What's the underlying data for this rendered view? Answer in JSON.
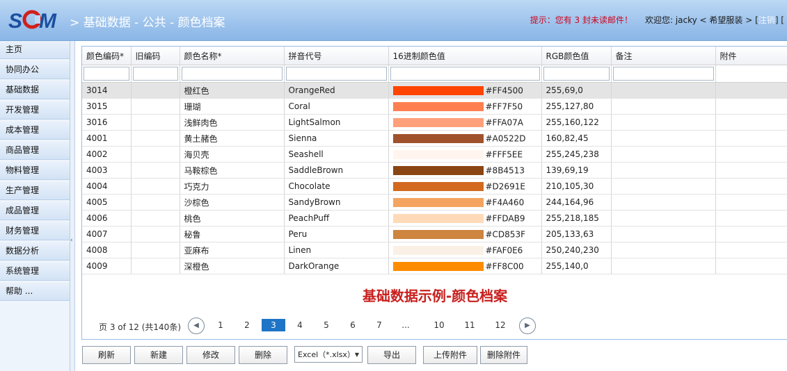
{
  "header": {
    "logo_text": "SCM",
    "breadcrumb": "> 基础数据 - 公共 - 颜色档案",
    "notice": "提示：您有 3 封未读邮件！",
    "welcome": "欢迎您: jacky < 希望服装 > [",
    "logout": "注销",
    "tail": "] ["
  },
  "sidebar": {
    "items": [
      {
        "label": "主页"
      },
      {
        "label": "协同办公"
      },
      {
        "label": "基础数据"
      },
      {
        "label": "开发管理"
      },
      {
        "label": "成本管理"
      },
      {
        "label": "商品管理"
      },
      {
        "label": "物料管理"
      },
      {
        "label": "生产管理"
      },
      {
        "label": "成品管理"
      },
      {
        "label": "财务管理"
      },
      {
        "label": "数据分析"
      },
      {
        "label": "系统管理"
      },
      {
        "label": "帮助 ..."
      }
    ],
    "collapse_icon": "‹"
  },
  "grid": {
    "columns": [
      "颜色编码*",
      "旧编码",
      "颜色名称*",
      "拼音代号",
      "16进制颜色值",
      "RGB颜色值",
      "备注",
      "附件"
    ],
    "rows": [
      {
        "code": "3014",
        "old": "",
        "name": "橙红色",
        "pinyin": "OrangeRed",
        "hex": "#FF4500",
        "rgb": "255,69,0",
        "selected": true
      },
      {
        "code": "3015",
        "old": "",
        "name": "珊瑚",
        "pinyin": "Coral",
        "hex": "#FF7F50",
        "rgb": "255,127,80"
      },
      {
        "code": "3016",
        "old": "",
        "name": "浅鲜肉色",
        "pinyin": "LightSalmon",
        "hex": "#FFA07A",
        "rgb": "255,160,122"
      },
      {
        "code": "4001",
        "old": "",
        "name": "黄土赭色",
        "pinyin": "Sienna",
        "hex": "#A0522D",
        "rgb": "160,82,45"
      },
      {
        "code": "4002",
        "old": "",
        "name": "海贝壳",
        "pinyin": "Seashell",
        "hex": "#FFF5EE",
        "rgb": "255,245,238"
      },
      {
        "code": "4003",
        "old": "",
        "name": "马鞍棕色",
        "pinyin": "SaddleBrown",
        "hex": "#8B4513",
        "rgb": "139,69,19"
      },
      {
        "code": "4004",
        "old": "",
        "name": "巧克力",
        "pinyin": "Chocolate",
        "hex": "#D2691E",
        "rgb": "210,105,30"
      },
      {
        "code": "4005",
        "old": "",
        "name": "沙棕色",
        "pinyin": "SandyBrown",
        "hex": "#F4A460",
        "rgb": "244,164,96"
      },
      {
        "code": "4006",
        "old": "",
        "name": "桃色",
        "pinyin": "PeachPuff",
        "hex": "#FFDAB9",
        "rgb": "255,218,185"
      },
      {
        "code": "4007",
        "old": "",
        "name": "秘鲁",
        "pinyin": "Peru",
        "hex": "#CD853F",
        "rgb": "205,133,63"
      },
      {
        "code": "4008",
        "old": "",
        "name": "亚麻布",
        "pinyin": "Linen",
        "hex": "#FAF0E6",
        "rgb": "250,240,230"
      },
      {
        "code": "4009",
        "old": "",
        "name": "深橙色",
        "pinyin": "DarkOrange",
        "hex": "#FF8C00",
        "rgb": "255,140,0"
      }
    ]
  },
  "caption": "基础数据示例-颜色档案",
  "pager": {
    "info": "页 3 of 12 (共140条)",
    "prev_icon": "prev-page-icon",
    "next_icon": "next-page-icon",
    "pages": [
      "1",
      "2",
      "3",
      "4",
      "5",
      "6",
      "7",
      "...",
      "10",
      "11",
      "12"
    ],
    "current": "3"
  },
  "toolbar": {
    "refresh": "刷新",
    "new": "新建",
    "edit": "修改",
    "delete": "删除",
    "export_format": "Excel（*.xlsx）",
    "export": "导出",
    "upload": "上传附件",
    "delete_attachment": "删除附件"
  },
  "colors": {
    "header_top": "#bcd8f4",
    "header_bottom": "#8ab6e6",
    "logo_blue": "#1b4fa0",
    "logo_red": "#d0201c",
    "notice_red": "#d0021b",
    "page_current": "#1e74c6",
    "caption_red": "#c8201e"
  }
}
